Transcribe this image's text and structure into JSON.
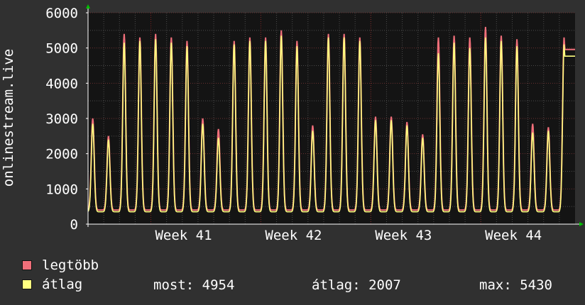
{
  "chart_data": {
    "type": "line",
    "ylabel": "onlinestream.live",
    "ylim": [
      0,
      6000
    ],
    "yticks": [
      0,
      1000,
      2000,
      3000,
      4000,
      5000,
      6000
    ],
    "x_tick_labels": [
      "Week 41",
      "Week 42",
      "Week 43",
      "Week 44"
    ],
    "x_range_days": [
      0,
      31
    ],
    "x_tick_positions_days": [
      4,
      11,
      18,
      25
    ],
    "grid": true,
    "series": [
      {
        "name": "legtöbb",
        "color": "#f06f7a",
        "daily_peaks": [
          3000,
          2500,
          5400,
          5300,
          5400,
          5300,
          5200,
          3000,
          2700,
          5200,
          5300,
          5300,
          5500,
          5200,
          2800,
          5400,
          5400,
          5300,
          3050,
          3050,
          2900,
          2550,
          5300,
          5350,
          5300,
          5600,
          5350,
          5250,
          2850,
          2750,
          5300
        ],
        "night_minimum": 400
      },
      {
        "name": "átlag",
        "color": "#ffff80",
        "daily_peaks": [
          2850,
          2400,
          5150,
          5200,
          5250,
          5150,
          5050,
          2850,
          2450,
          5100,
          5200,
          5200,
          5350,
          5050,
          2650,
          5300,
          5300,
          5200,
          2950,
          2950,
          2800,
          2450,
          4850,
          5150,
          5000,
          5300,
          5200,
          5050,
          2600,
          2650,
          5100
        ],
        "night_minimum": 350
      }
    ],
    "legend_position": "bottom-left"
  },
  "legend": {
    "max_label": "legtöbb",
    "avg_label": "átlag"
  },
  "stats": {
    "current": "most: 4954",
    "average": "átlag: 2007",
    "maximum": "max: 5430"
  },
  "colors": {
    "background": "#303030",
    "plot_background": "#141414",
    "grid": "#4a4a4a",
    "axis": "#ffffff",
    "arrow": "#00c000",
    "week_line": "#7a2020"
  }
}
